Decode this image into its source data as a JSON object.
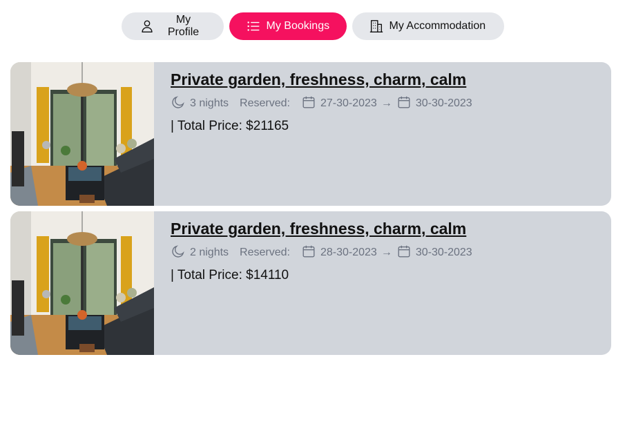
{
  "nav": {
    "profile_label": "My Profile",
    "bookings_label": "My Bookings",
    "accommodation_label": "My Accommodation",
    "accent_color": "#f5115f"
  },
  "bookings": [
    {
      "title": "Private garden, freshness, charm, calm",
      "nights": "3 nights",
      "reserved_label": "Reserved:",
      "check_in": "27-30-2023",
      "arrow": "→",
      "check_out": "30-30-2023",
      "price": "| Total Price: $21165"
    },
    {
      "title": "Private garden, freshness, charm, calm",
      "nights": "2 nights",
      "reserved_label": "Reserved:",
      "check_in": "28-30-2023",
      "arrow": "→",
      "check_out": "30-30-2023",
      "price": "| Total Price: $14110"
    }
  ],
  "icons": [
    "user-icon",
    "list-icon",
    "building-icon",
    "moon-icon",
    "calendar-icon",
    "arrow-right-icon"
  ]
}
